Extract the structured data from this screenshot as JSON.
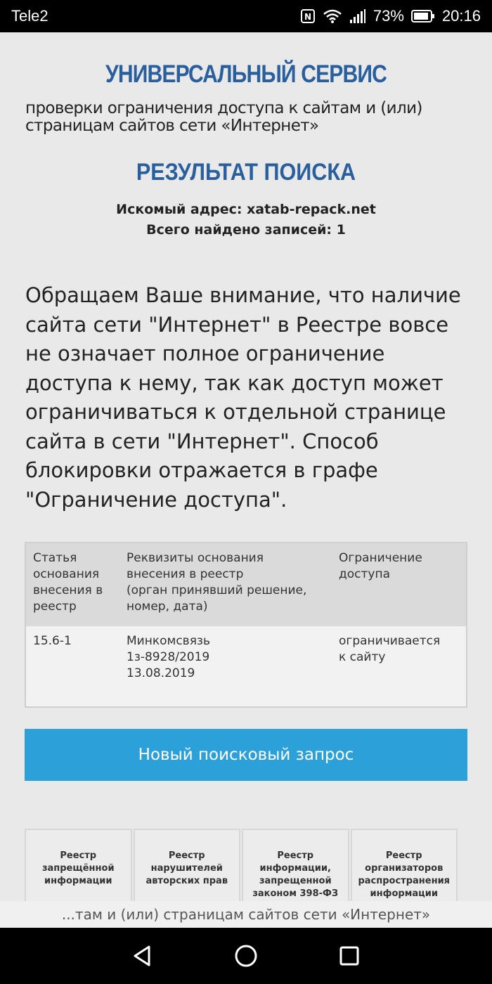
{
  "status_bar": {
    "carrier": "Tele2",
    "battery": "73%",
    "time": "20:16"
  },
  "header": {
    "title": "УНИВЕРСАЛЬНЫЙ СЕРВИС",
    "subtitle_line1": "проверки ограничения доступа к сайтам и (или)",
    "subtitle_line2": "страницам сайтов сети «Интернет»"
  },
  "result": {
    "title": "РЕЗУЛЬТАТ ПОИСКА",
    "searched_address": "Искомый адрес: xatab-repack.net",
    "total_found": "Всего найдено записей: 1"
  },
  "notice": "Обращаем Ваше внимание, что наличие сайта сети \"Интернет\" в Реестре вовсе не означает полное ограничение доступа к нему, так как доступ может ограничиваться к отдельной странице сайта в сети \"Интернет\". Способ блокировки отражается в графе \"Ограничение доступа\".",
  "table": {
    "headers": {
      "article": [
        "Статья",
        "основания",
        "внесения в",
        "реестр"
      ],
      "details": [
        "Реквизиты основания",
        "внесения в реестр",
        "(орган принявший решение,",
        "номер, дата)"
      ],
      "restriction": [
        "Ограничение",
        "доступа"
      ]
    },
    "row": {
      "article": "15.6-1",
      "details": [
        "Минкомсвязь",
        "1з-8928/2019",
        "13.08.2019"
      ],
      "restriction": [
        "ограничивается",
        "к сайту"
      ]
    }
  },
  "new_search_label": "Новый поисковый запрос",
  "registries": [
    [
      "Реестр",
      "запрещённой",
      "информации"
    ],
    [
      "Реестр",
      "нарушителей",
      "авторских прав"
    ],
    [
      "Реестр",
      "информации,",
      "запрещенной",
      "законом 398-ФЗ"
    ],
    [
      "Реестр",
      "организаторов",
      "распространения",
      "информации"
    ]
  ],
  "bottom_banner": "...там и (или) страницам сайтов сети «Интернет»",
  "icons": [
    "nfc-icon",
    "wifi-icon",
    "signal-icon",
    "battery-icon",
    "back-icon",
    "home-icon",
    "recents-icon"
  ]
}
